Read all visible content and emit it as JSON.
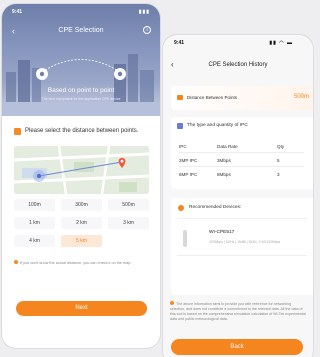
{
  "screen1": {
    "time": "9:41",
    "title": "CPE Selection",
    "hero_heading": "Based on point to point",
    "hero_subtitle": "The best equipment for the application CPE device",
    "prompt": "Please select the distance between points.",
    "distances": [
      "100m",
      "300m",
      "500m",
      "1 km",
      "2 km",
      "3 km",
      "4 km",
      "5 km"
    ],
    "selected_distance": "5 km",
    "hint": "If you don't know the actual distance, you can check it on the map.",
    "next_label": "Next"
  },
  "screen2": {
    "time": "9:41",
    "title": "CPE Selection History",
    "distance_label": "Distance Between Points",
    "distance_value": "500m",
    "ipc_title": "The type and quantity of IPC",
    "table_headers": [
      "IPC",
      "Data Rate",
      "Qty"
    ],
    "table_rows": [
      [
        "2MP IPC",
        "3Mbps",
        "5"
      ],
      [
        "6MP IPC",
        "8Mbps",
        "3"
      ]
    ],
    "recommended_title": "Recommended Devices:",
    "device_name": "WI-CPE517",
    "device_spec": "300Mbps | 5GHz | 15dBi | 5KM | 1*10/100Mbps",
    "disclaimer": "The above information aims to provide you with reference for networking selection, and does not constitute a commitment to the relevant data. All the data of this tool is based on the comprehensive simulation calculation of Wi-Tek experimental data and public meteorological data.",
    "back_label": "Back"
  },
  "colors": {
    "accent": "#f5851f",
    "hero": "#7f8fbb"
  }
}
